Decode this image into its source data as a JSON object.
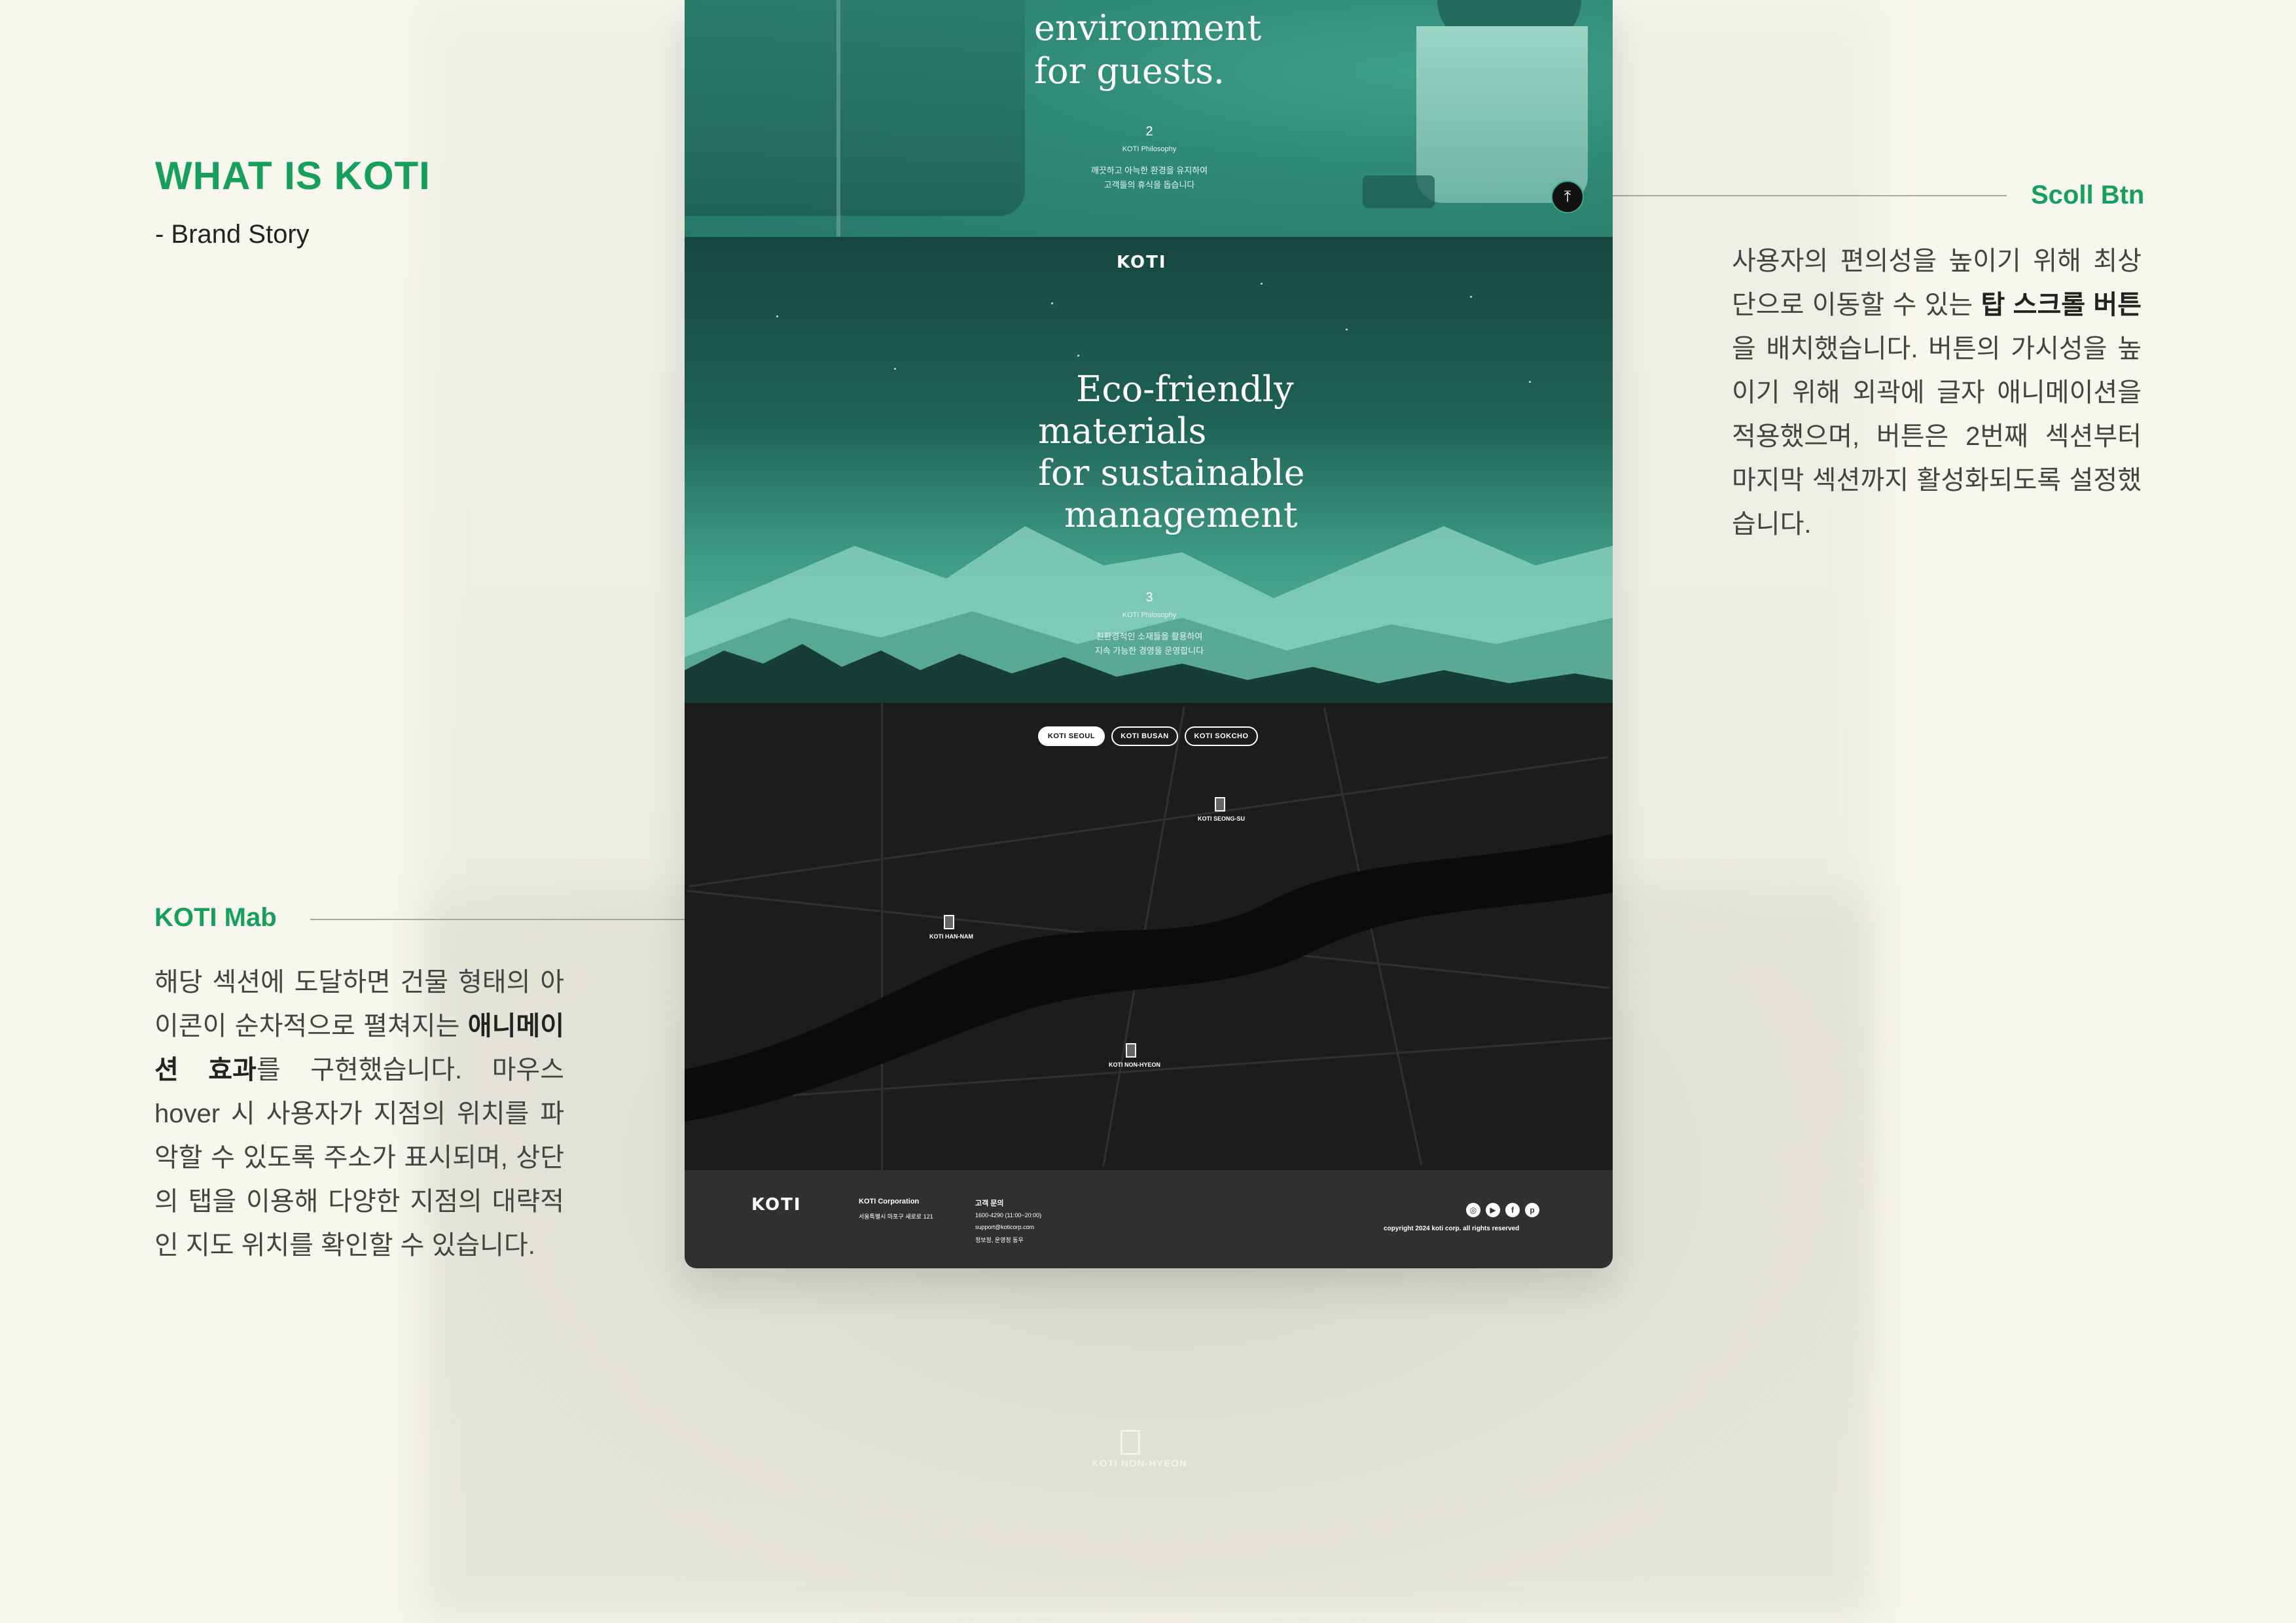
{
  "annotations": {
    "story_title": "WHAT IS KOTI",
    "story_sub": "- Brand Story",
    "scroll_label": "Scoll Btn",
    "scroll_body_1": "사용자의 편의성을 높이기 위해 최상단으로 이동할 수 있는 ",
    "scroll_body_bold": "탑 스크롤 버튼",
    "scroll_body_2": "을 배치했습니다. 버튼의 가시성을 높이기 위해 외곽에 글자 애니메이션을 적용했으며, 버튼은 2번째 섹션부터 마지막 섹션까지 활성화되도록 설정했습니다.",
    "map_label": "KOTI Mab",
    "map_body_1": "해당 섹션에 도달하면 건물 형태의 아이콘이 순차적으로 펼쳐지는 ",
    "map_body_bold": "애니메이션 효과",
    "map_body_2": "를 구현했습니다. 마우스 hover 시 사용자가 지점의 위치를 파악할 수 있도록 주소가 표시되며, 상단의 탭을 이용해 다양한 지점의 대략적인 지도 위치를 확인할 수 있습니다."
  },
  "section1": {
    "headline_1": "environment",
    "headline_2": "for guests.",
    "number": "2",
    "name": "KOTI Philosophy",
    "desc_1": "깨끗하고 아늑한 환경을 유지하여",
    "desc_2": "고객들의 휴식을 돕습니다"
  },
  "section2": {
    "logo": "KOTI",
    "headline_1": "Eco-friendly",
    "headline_2": "materials",
    "headline_3": "for sustainable",
    "headline_4": "management",
    "number": "3",
    "name": "KOTI Philosophy",
    "desc_1": "친환경적인 소재들을 활용하여",
    "desc_2": "지속 가능한 경영을 운영합니다"
  },
  "top_button": {
    "icon": "arrow-up-icon",
    "glyph": "⤒"
  },
  "map": {
    "tabs": [
      "KOTI SEOUL",
      "KOTI BUSAN",
      "KOTI SOKCHO"
    ],
    "active_tab": "KOTI SEOUL",
    "pins": [
      "KOTI SEONG-SU",
      "KOTI HAN-NAM",
      "KOTI NON-HYEON"
    ]
  },
  "footer": {
    "logo": "KOTI",
    "company": "KOTI Corporation",
    "address": "서울특별시 마포구 새로로 121",
    "contact_title": "고객 문의",
    "phone": "1600-4290 (11:00~20:00)",
    "email": "support@koticorp.com",
    "links": "정보정, 운영정 동우",
    "copyright": "copyright 2024 koti corp. all rights reserved",
    "social_icons": [
      "instagram-icon",
      "youtube-icon",
      "facebook-icon",
      "pinterest-icon"
    ]
  },
  "ghost": {
    "label": "KOTI NON-HYEON"
  },
  "colors": {
    "accent": "#17a05d",
    "teal": "#2f8a76",
    "map_bg": "#1c1c1c",
    "footer": "#303030",
    "page_bg": "#f8f7ee"
  }
}
